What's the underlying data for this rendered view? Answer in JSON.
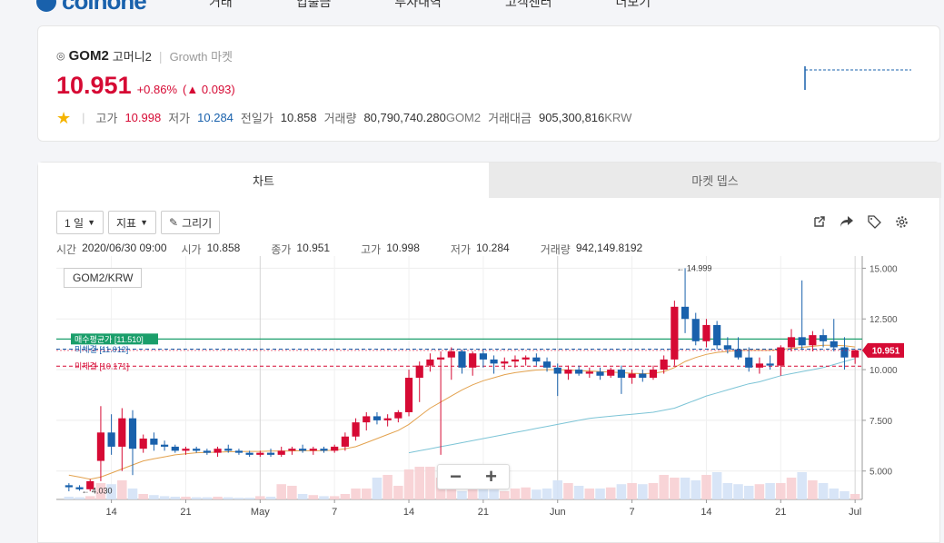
{
  "nav": {
    "logo_text": "coinone",
    "items": [
      "거래",
      "입출금",
      "투자내역",
      "고객센터",
      "더보기"
    ]
  },
  "coin": {
    "icon": "coin-logo-icon",
    "symbol": "GOM2",
    "name": "고머니2",
    "market": "Growth 마켓",
    "price": "10.951",
    "change_pct": "+0.86%",
    "change_abs": "▲ 0.093",
    "stats": {
      "high_label": "고가",
      "high": "10.998",
      "low_label": "저가",
      "low": "10.284",
      "prev_label": "전일가",
      "prev": "10.858",
      "volume_label": "거래량",
      "volume": "80,790,740.280",
      "volume_unit": "GOM2",
      "amount_label": "거래대금",
      "amount": "905,300,816",
      "amount_unit": "KRW"
    }
  },
  "tabs": {
    "chart": "차트",
    "depth": "마켓 뎁스"
  },
  "toolbar": {
    "interval": "1 일",
    "indicator": "지표",
    "draw": "그리기"
  },
  "ohlc": {
    "time_label": "시간",
    "time": "2020/06/30 09:00",
    "open_label": "시가",
    "open": "10.858",
    "close_label": "종가",
    "close": "10.951",
    "high_label": "고가",
    "high": "10.998",
    "low_label": "저가",
    "low": "10.284",
    "vol_label": "거래량",
    "vol": "942,149.8192"
  },
  "pair": "GOM2/KRW",
  "zoom": {
    "minus": "−",
    "plus": "+"
  },
  "colors": {
    "up": "#d60a34",
    "down": "#1961ac",
    "ma_short": "#e3a24e",
    "ma_long": "#7cc4d6",
    "buy_avg": "#1a9e6a"
  },
  "chart_data": {
    "type": "candlestick",
    "y_ticks": [
      "15.000",
      "12.500",
      "10.000",
      "7.500",
      "5.000"
    ],
    "y_tick_values": [
      15,
      12.5,
      10,
      7.5,
      5
    ],
    "ylim": [
      3.6,
      15.6
    ],
    "x_ticks": [
      "14",
      "21",
      "May",
      "7",
      "14",
      "21",
      "Jun",
      "7",
      "14",
      "21",
      "Jul"
    ],
    "x_tick_index": [
      4,
      11,
      18,
      25,
      32,
      39,
      46,
      53,
      60,
      67,
      74
    ],
    "current_price": "10.951",
    "current_value": 10.951,
    "max_label": "← 14.999",
    "max_value": 14.999,
    "max_index": 57,
    "min_label": "← 4.030",
    "min_value": 4.03,
    "min_index": 1,
    "lines": [
      {
        "label": "매수평균가 [11.510]",
        "value": 11.51,
        "color": "#1a9e6a",
        "style": "solid"
      },
      {
        "label": "미체결 [11.012]",
        "value": 11.012,
        "color": "#1961ac",
        "style": "dashed"
      },
      {
        "label": "미체결 [10.171]",
        "value": 10.171,
        "color": "#d60a34",
        "style": "dashed"
      }
    ],
    "candles": [
      [
        4.3,
        4.4,
        4.0,
        4.2
      ],
      [
        4.2,
        4.3,
        4.03,
        4.1
      ],
      [
        4.1,
        4.6,
        4.0,
        4.5
      ],
      [
        5.5,
        8.2,
        4.5,
        6.9
      ],
      [
        6.9,
        7.8,
        5.8,
        6.2
      ],
      [
        6.2,
        8.1,
        5.0,
        7.6
      ],
      [
        7.6,
        8.0,
        4.8,
        6.1
      ],
      [
        6.1,
        6.8,
        5.9,
        6.6
      ],
      [
        6.6,
        6.9,
        6.0,
        6.3
      ],
      [
        6.3,
        6.5,
        6.0,
        6.2
      ],
      [
        6.2,
        6.3,
        5.9,
        6.0
      ],
      [
        6.0,
        6.2,
        5.8,
        6.1
      ],
      [
        6.1,
        6.2,
        5.9,
        6.0
      ],
      [
        6.0,
        6.1,
        5.8,
        5.9
      ],
      [
        5.9,
        6.2,
        5.7,
        6.1
      ],
      [
        6.1,
        6.3,
        5.9,
        6.0
      ],
      [
        6.0,
        6.1,
        5.8,
        5.9
      ],
      [
        5.9,
        6.0,
        5.7,
        5.8
      ],
      [
        5.8,
        6.0,
        5.7,
        5.9
      ],
      [
        5.9,
        6.1,
        5.7,
        5.8
      ],
      [
        5.8,
        6.2,
        5.7,
        6.0
      ],
      [
        6.0,
        6.2,
        5.8,
        6.1
      ],
      [
        6.1,
        6.3,
        5.9,
        6.0
      ],
      [
        6.0,
        6.2,
        5.8,
        6.1
      ],
      [
        6.1,
        6.2,
        5.9,
        6.0
      ],
      [
        6.0,
        6.3,
        5.9,
        6.2
      ],
      [
        6.2,
        6.9,
        6.0,
        6.7
      ],
      [
        6.7,
        7.6,
        6.5,
        7.4
      ],
      [
        7.4,
        7.9,
        7.0,
        7.7
      ],
      [
        7.7,
        7.9,
        7.3,
        7.5
      ],
      [
        7.5,
        7.8,
        7.2,
        7.6
      ],
      [
        7.6,
        8.0,
        7.4,
        7.9
      ],
      [
        7.9,
        10.0,
        7.7,
        9.6
      ],
      [
        9.6,
        10.4,
        8.4,
        10.2
      ],
      [
        10.2,
        10.8,
        9.9,
        10.5
      ],
      [
        10.5,
        10.9,
        5.8,
        10.6
      ],
      [
        10.6,
        11.1,
        9.5,
        10.9
      ],
      [
        10.9,
        11.0,
        9.8,
        10.1
      ],
      [
        10.1,
        10.9,
        9.7,
        10.8
      ],
      [
        10.8,
        11.0,
        10.1,
        10.5
      ],
      [
        10.5,
        10.7,
        9.8,
        10.3
      ],
      [
        10.3,
        10.6,
        10.0,
        10.4
      ],
      [
        10.4,
        10.7,
        10.1,
        10.5
      ],
      [
        10.5,
        10.7,
        10.2,
        10.6
      ],
      [
        10.6,
        10.8,
        10.2,
        10.4
      ],
      [
        10.4,
        10.6,
        9.9,
        10.1
      ],
      [
        10.1,
        10.3,
        8.7,
        9.8
      ],
      [
        9.8,
        10.2,
        9.5,
        10.0
      ],
      [
        10.0,
        10.2,
        9.7,
        9.8
      ],
      [
        9.8,
        10.1,
        9.6,
        9.9
      ],
      [
        9.9,
        10.1,
        9.5,
        9.7
      ],
      [
        9.7,
        10.1,
        9.6,
        10.0
      ],
      [
        10.0,
        10.2,
        8.8,
        9.6
      ],
      [
        9.6,
        10.0,
        9.3,
        9.8
      ],
      [
        9.8,
        10.0,
        9.4,
        9.6
      ],
      [
        9.6,
        10.2,
        9.5,
        10.0
      ],
      [
        10.0,
        10.7,
        9.8,
        10.5
      ],
      [
        10.5,
        13.4,
        10.2,
        13.1
      ],
      [
        13.1,
        14.999,
        11.8,
        12.5
      ],
      [
        12.5,
        12.8,
        11.2,
        11.4
      ],
      [
        11.4,
        12.5,
        11.1,
        12.2
      ],
      [
        12.2,
        12.4,
        11.0,
        11.2
      ],
      [
        11.2,
        11.6,
        10.8,
        11.0
      ],
      [
        11.0,
        11.6,
        10.5,
        10.6
      ],
      [
        10.6,
        11.1,
        9.9,
        10.1
      ],
      [
        10.1,
        10.6,
        9.8,
        10.3
      ],
      [
        10.3,
        10.7,
        10.0,
        10.2
      ],
      [
        10.2,
        11.2,
        9.7,
        11.1
      ],
      [
        11.1,
        12.0,
        10.9,
        11.6
      ],
      [
        11.6,
        14.4,
        11.0,
        11.2
      ],
      [
        11.2,
        11.9,
        10.9,
        11.7
      ],
      [
        11.7,
        12.0,
        11.1,
        11.4
      ],
      [
        11.4,
        12.5,
        10.9,
        11.1
      ],
      [
        11.1,
        11.6,
        10.0,
        10.6
      ],
      [
        10.6,
        11.0,
        10.284,
        10.951
      ]
    ],
    "ma_short": [
      4.8,
      4.7,
      4.6,
      4.7,
      4.9,
      5.1,
      5.3,
      5.5,
      5.6,
      5.7,
      5.8,
      5.85,
      5.9,
      5.92,
      5.93,
      5.95,
      5.96,
      5.97,
      5.97,
      5.98,
      5.98,
      5.99,
      6.0,
      6.0,
      6.01,
      6.03,
      6.1,
      6.2,
      6.4,
      6.6,
      6.8,
      7.0,
      7.3,
      7.7,
      8.1,
      8.4,
      8.7,
      9.0,
      9.25,
      9.45,
      9.6,
      9.75,
      9.85,
      9.92,
      9.98,
      10.0,
      10.0,
      9.98,
      9.95,
      9.93,
      9.9,
      9.88,
      9.85,
      9.82,
      9.8,
      9.82,
      9.9,
      10.1,
      10.4,
      10.6,
      10.75,
      10.85,
      10.9,
      10.95,
      10.95,
      10.95,
      10.95,
      11.0,
      11.05,
      11.1,
      11.15,
      11.2,
      11.2,
      11.18,
      11.12
    ],
    "ma_long": [
      null,
      null,
      null,
      null,
      null,
      null,
      null,
      null,
      null,
      null,
      null,
      null,
      null,
      null,
      null,
      null,
      null,
      null,
      null,
      null,
      null,
      null,
      null,
      null,
      null,
      null,
      null,
      null,
      null,
      null,
      null,
      null,
      5.9,
      6.0,
      6.1,
      6.2,
      6.3,
      6.4,
      6.5,
      6.6,
      6.7,
      6.8,
      6.9,
      7.0,
      7.1,
      7.2,
      7.3,
      7.4,
      7.5,
      7.6,
      7.65,
      7.7,
      7.75,
      7.8,
      7.85,
      7.9,
      8.0,
      8.1,
      8.3,
      8.5,
      8.7,
      8.85,
      9.0,
      9.15,
      9.3,
      9.4,
      9.55,
      9.7,
      9.8,
      9.9,
      10.0,
      10.1,
      10.25,
      10.4,
      10.55
    ],
    "volumes": [
      0.05,
      0.04,
      0.06,
      0.3,
      0.28,
      0.35,
      0.2,
      0.1,
      0.08,
      0.06,
      0.05,
      0.05,
      0.04,
      0.04,
      0.05,
      0.04,
      0.03,
      0.03,
      0.06,
      0.05,
      0.28,
      0.25,
      0.1,
      0.08,
      0.06,
      0.06,
      0.1,
      0.2,
      0.2,
      0.4,
      0.45,
      0.25,
      0.55,
      0.6,
      0.6,
      0.4,
      0.3,
      0.15,
      0.22,
      0.2,
      0.18,
      0.15,
      0.2,
      0.22,
      0.18,
      0.2,
      0.35,
      0.3,
      0.25,
      0.2,
      0.2,
      0.22,
      0.28,
      0.3,
      0.28,
      0.3,
      0.45,
      0.4,
      0.4,
      0.35,
      0.45,
      0.5,
      0.3,
      0.28,
      0.25,
      0.28,
      0.3,
      0.3,
      0.4,
      0.5,
      0.35,
      0.3,
      0.2,
      0.15,
      0.1
    ]
  }
}
